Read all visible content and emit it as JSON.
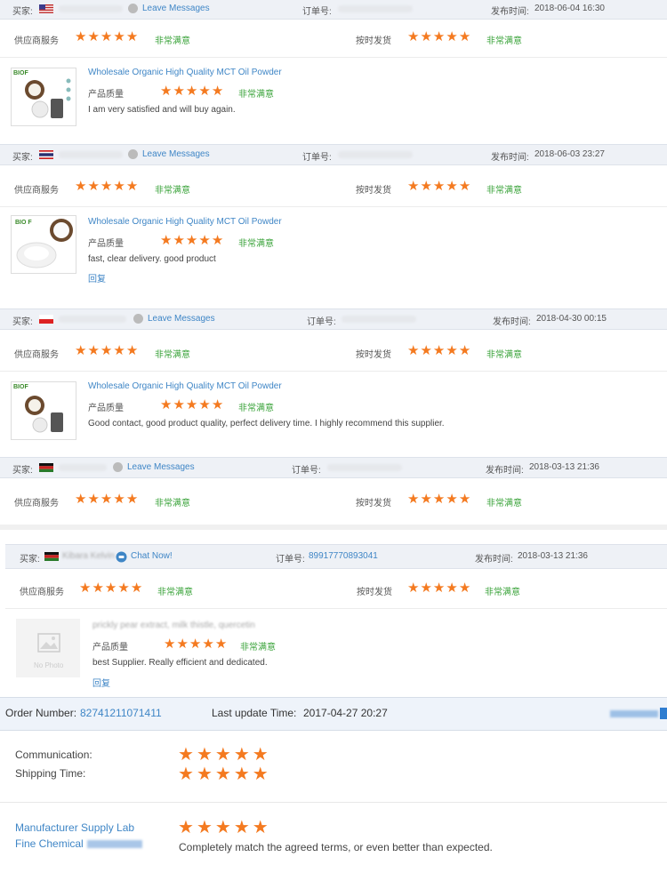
{
  "reviews": [
    {
      "buyer_label": "买家:",
      "leave_messages": "Leave Messages",
      "order_label": "订单号:",
      "publish_label": "发布时间:",
      "publish_time": "2018-06-04 16:30",
      "flag": "us",
      "supplier_label": "供应商服务",
      "supplier_rating": "非常满意",
      "shipping_label": "按时发货",
      "shipping_rating": "非常满意",
      "product_title": "Wholesale Organic High Quality MCT Oil Powder",
      "quality_label": "产品质量",
      "quality_rating": "非常满意",
      "comment": "I am very satisfied and will buy again.",
      "reply": ""
    },
    {
      "buyer_label": "买家:",
      "leave_messages": "Leave Messages",
      "order_label": "订单号:",
      "publish_label": "发布时间:",
      "publish_time": "2018-06-03 23:27",
      "flag": "th",
      "supplier_label": "供应商服务",
      "supplier_rating": "非常满意",
      "shipping_label": "按时发货",
      "shipping_rating": "非常满意",
      "product_title": "Wholesale Organic High Quality MCT Oil Powder",
      "quality_label": "产品质量",
      "quality_rating": "非常满意",
      "comment": "fast, clear delivery. good product",
      "reply": "回复"
    },
    {
      "buyer_label": "买家:",
      "leave_messages": "Leave Messages",
      "order_label": "订单号:",
      "publish_label": "发布时间:",
      "publish_time": "2018-04-30 00:15",
      "flag": "pl",
      "supplier_label": "供应商服务",
      "supplier_rating": "非常满意",
      "shipping_label": "按时发货",
      "shipping_rating": "非常满意",
      "product_title": "Wholesale Organic High Quality MCT Oil Powder",
      "quality_label": "产品质量",
      "quality_rating": "非常满意",
      "comment": "Good contact, good product quality, perfect delivery time. I highly recommend this supplier.",
      "reply": ""
    },
    {
      "buyer_label": "买家:",
      "leave_messages": "Leave Messages",
      "order_label": "订单号:",
      "publish_label": "发布时间:",
      "publish_time": "2018-03-13 21:36",
      "flag": "ke",
      "supplier_label": "供应商服务",
      "supplier_rating": "非常满意",
      "shipping_label": "按时发货",
      "shipping_rating": "非常满意"
    }
  ],
  "review5": {
    "buyer_label": "买家:",
    "buyer_name": "Kibara Kelvin",
    "chat_now": "Chat Now!",
    "order_label": "订单号:",
    "order_number": "89917770893041",
    "publish_label": "发布时间:",
    "publish_time": "2018-03-13 21:36",
    "supplier_label": "供应商服务",
    "supplier_rating": "非常满意",
    "shipping_label": "按时发货",
    "shipping_rating": "非常满意",
    "product_title": "prickly pear extract, milk thistle, quercetin",
    "no_photo": "No Photo",
    "quality_label": "产品质量",
    "quality_rating": "非常满意",
    "comment": "best Supplier. Really efficient and dedicated.",
    "reply": "回复"
  },
  "order_section": {
    "order_number_label": "Order Number:",
    "order_number": "82741211071411",
    "last_update_label": "Last update Time:",
    "last_update_time": "2017-04-27 20:27",
    "communication_label": "Communication:",
    "shipping_time_label": "Shipping Time:",
    "company_line1": "Manufacturer Supply Lab",
    "company_line2": "Fine Chemical",
    "feedback": "Completely match the agreed terms, or even better than expected."
  },
  "ratings": {
    "stars_out_of_5": 5
  },
  "colors": {
    "star": "#f47a20",
    "link": "#3f86c6",
    "satisfied": "#3aa33a",
    "header_bg": "#eef1f6"
  }
}
